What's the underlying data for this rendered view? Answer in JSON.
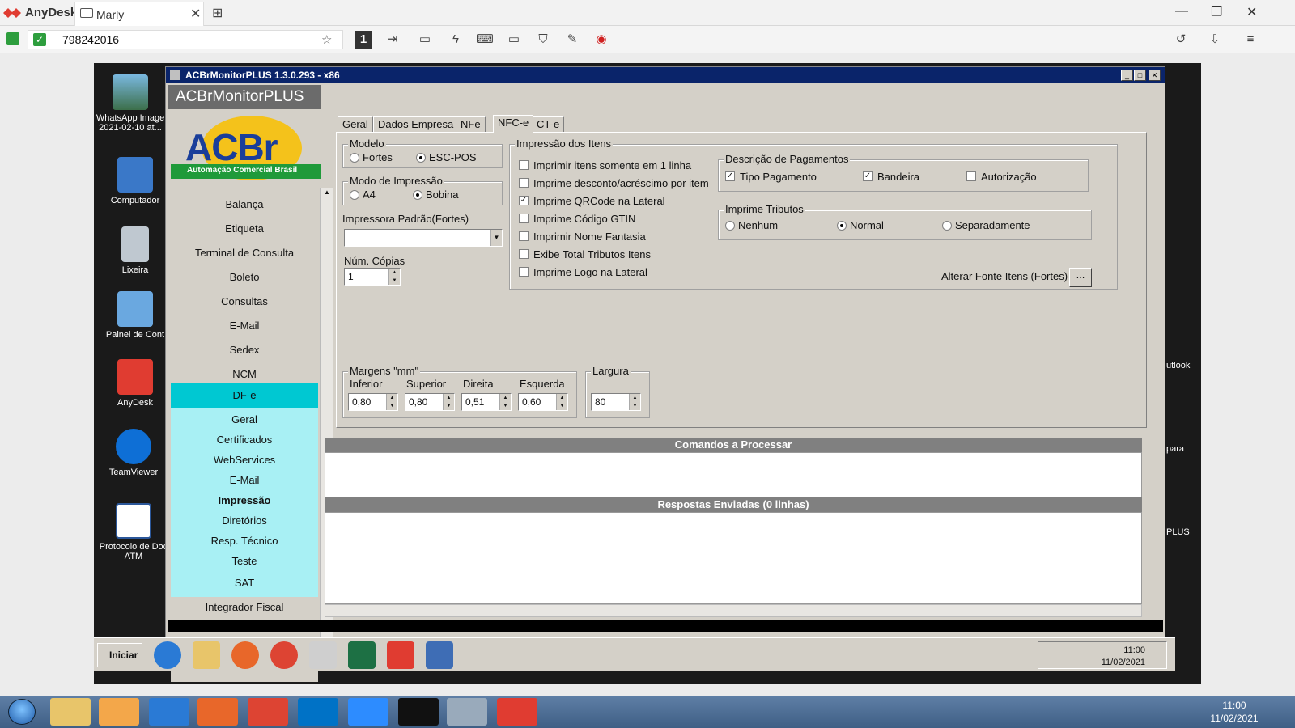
{
  "anydesk": {
    "brand": "AnyDesk",
    "tab_label": "Marly",
    "address": "798242016",
    "session_number": "1"
  },
  "remote": {
    "desktop_icons": [
      {
        "label": "WhatsApp Image 2021-02-10 at..."
      },
      {
        "label": "Computador"
      },
      {
        "label": "Lixeira"
      },
      {
        "label": "Painel de Cont"
      },
      {
        "label": "AnyDesk"
      },
      {
        "label": "TeamViewer"
      },
      {
        "label": "Protocolo de Doc ATM"
      }
    ],
    "right_fragments": {
      "outlook": "utlook",
      "para": "para",
      "plus": "PLUS"
    }
  },
  "acbr": {
    "title": "ACBrMonitorPLUS 1.3.0.293 - x86",
    "header": "ACBrMonitorPLUS",
    "logo_text": "ACBr",
    "logo_sub": "Automação Comercial Brasil",
    "nav": [
      "Balança",
      "Etiqueta",
      "Terminal de Consulta",
      "Boleto",
      "Consultas",
      "E-Mail",
      "Sedex",
      "NCM",
      "DF-e"
    ],
    "nav_sub": [
      "Geral",
      "Certificados",
      "WebServices",
      "E-Mail",
      "Impressão",
      "Diretórios",
      "Resp. Técnico",
      "Teste"
    ],
    "nav_after": [
      "SAT",
      "Integrador Fiscal"
    ],
    "tabs": [
      "Geral",
      "Dados Empresa",
      "NFe",
      "NFC-e",
      "CT-e"
    ],
    "modelo": {
      "title": "Modelo",
      "opt1": "Fortes",
      "opt2": "ESC-POS"
    },
    "modo": {
      "title": "Modo de Impressão",
      "opt1": "A4",
      "opt2": "Bobina"
    },
    "impressora_label": "Impressora Padrão(Fortes)",
    "copias_label": "Núm. Cópias",
    "copias_value": "1",
    "itens": {
      "title": "Impressão dos Itens",
      "checks": [
        {
          "label": "Imprimir itens somente em 1 linha",
          "checked": false
        },
        {
          "label": "Imprime desconto/acréscimo por item",
          "checked": false
        },
        {
          "label": "Imprime QRCode na Lateral",
          "checked": true
        },
        {
          "label": "Imprime Código GTIN",
          "checked": false
        },
        {
          "label": "Imprimir Nome Fantasia",
          "checked": false
        },
        {
          "label": "Exibe Total Tributos Itens",
          "checked": false
        },
        {
          "label": "Imprime Logo na Lateral",
          "checked": false
        }
      ]
    },
    "pagamentos": {
      "title": "Descrição de Pagamentos",
      "c1": "Tipo Pagamento",
      "c2": "Bandeira",
      "c3": "Autorização"
    },
    "tributos": {
      "title": "Imprime Tributos",
      "o1": "Nenhum",
      "o2": "Normal",
      "o3": "Separadamente"
    },
    "fonte_label": "Alterar Fonte Itens (Fortes)",
    "fonte_btn": "...",
    "margens": {
      "title": "Margens \"mm\"",
      "inferior": "Inferior",
      "superior": "Superior",
      "direita": "Direita",
      "esquerda": "Esquerda",
      "v_inf": "0,80",
      "v_sup": "0,80",
      "v_dir": "0,51",
      "v_esq": "0,60"
    },
    "largura": {
      "title": "Largura",
      "value": "80"
    },
    "comandos": "Comandos a Processar",
    "respostas": "Respostas Enviadas (0 linhas)"
  },
  "inner_taskbar": {
    "start": "Iniciar",
    "time": "11:00",
    "date": "11/02/2021"
  },
  "outer_taskbar": {
    "time": "11:00",
    "date": "11/02/2021"
  }
}
